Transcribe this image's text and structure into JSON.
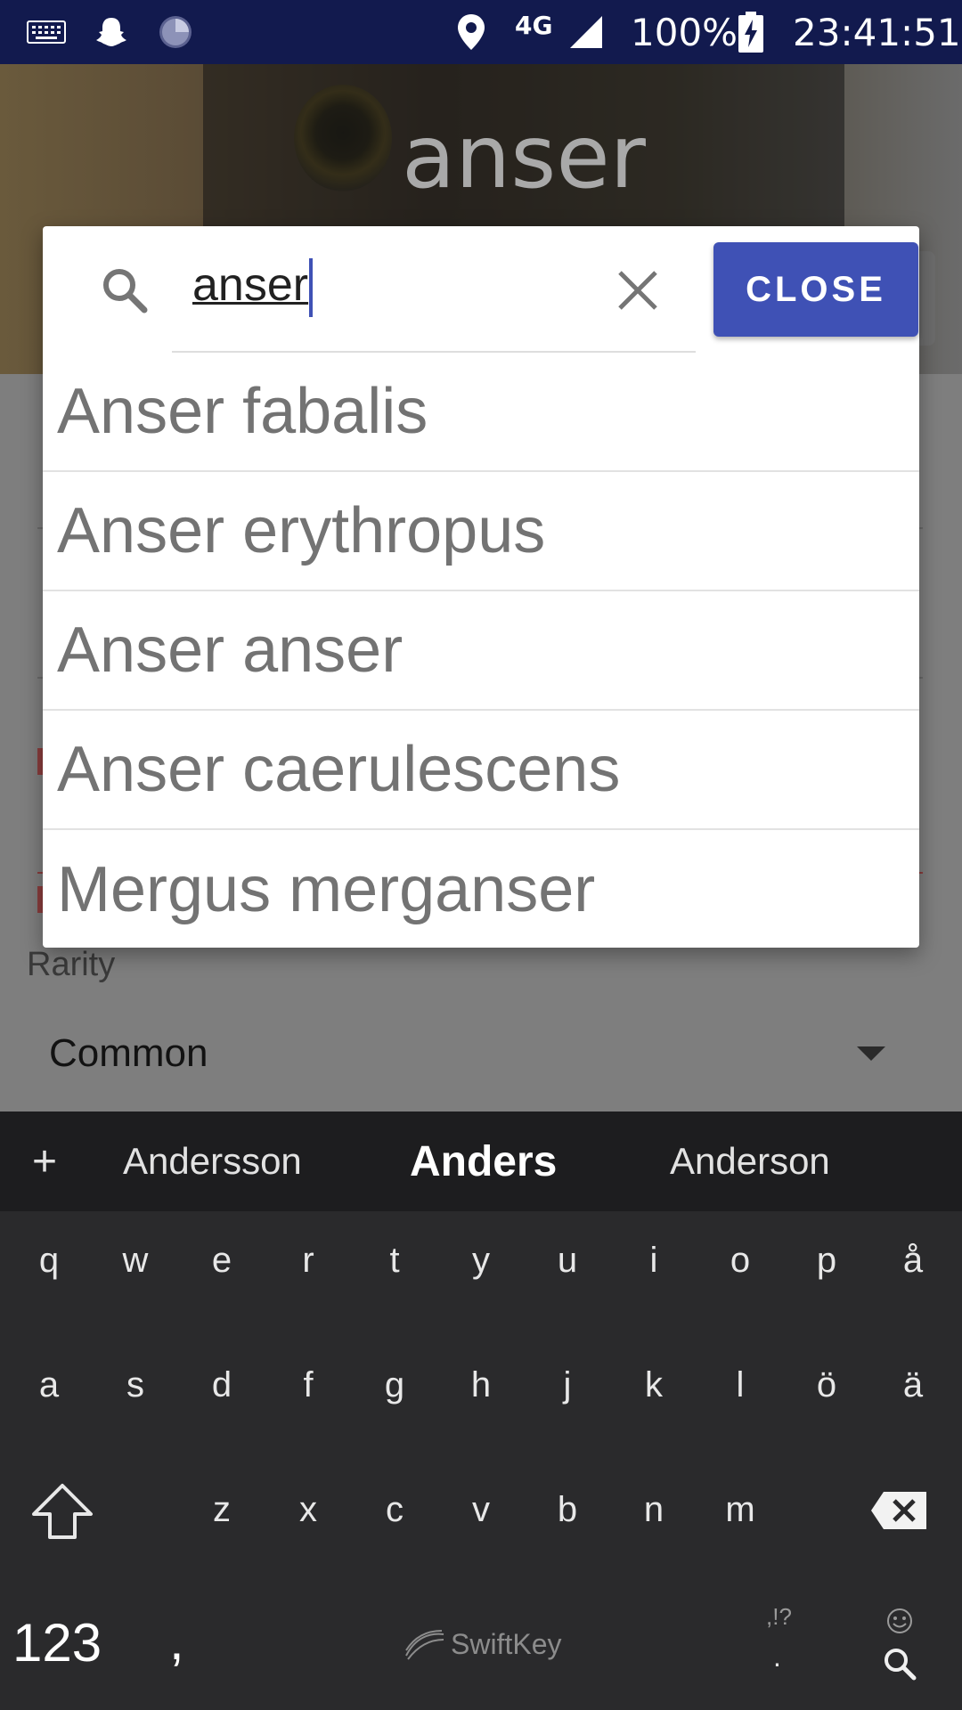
{
  "status_bar": {
    "network": "4G",
    "battery": "100%",
    "time": "23:41:51",
    "icons": [
      "keyboard-icon",
      "snapchat-ghost-icon",
      "loading-circle-icon",
      "location-pin-icon",
      "signal-icon",
      "battery-charging-icon"
    ]
  },
  "background_app": {
    "title": "anser",
    "rarity_label": "Rarity",
    "rarity_value": "Common"
  },
  "dialog": {
    "search_value": "anser",
    "close_label": "CLOSE",
    "results": [
      "Anser fabalis",
      "Anser erythropus",
      "Anser anser",
      "Anser caerulescens",
      "Mergus merganser"
    ],
    "accent_color": "#3f51b5"
  },
  "keyboard": {
    "suggestions": [
      "+",
      "Andersson",
      "Anders",
      "Anderson"
    ],
    "row1": [
      "q",
      "w",
      "e",
      "r",
      "t",
      "y",
      "u",
      "i",
      "o",
      "p",
      "å"
    ],
    "row2": [
      "a",
      "s",
      "d",
      "f",
      "g",
      "h",
      "j",
      "k",
      "l",
      "ö",
      "ä"
    ],
    "row3": [
      "z",
      "x",
      "c",
      "v",
      "b",
      "n",
      "m"
    ],
    "numbers_label": "123",
    "comma_label": ",",
    "brand": "SwiftKey",
    "punct_label": ",!?",
    "period_label": "."
  }
}
